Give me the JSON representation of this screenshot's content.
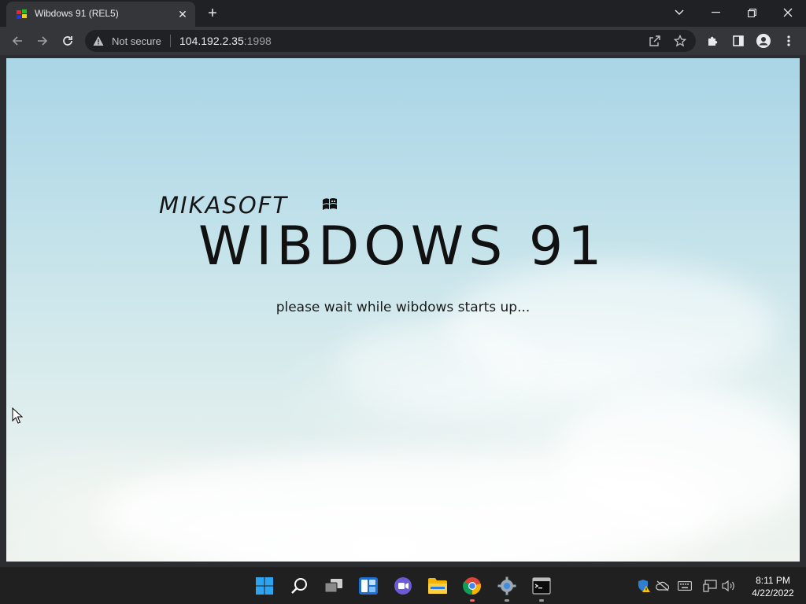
{
  "browser": {
    "tab": {
      "title": "Wibdows 91 (REL5)"
    },
    "address": {
      "security_label": "Not secure",
      "host": "104.192.2.35",
      "port": ":1998"
    }
  },
  "page": {
    "brand": "MIKASOFT",
    "product": "WIBDOWS 91",
    "status": "please wait while wibdows starts up..."
  },
  "taskbar": {
    "apps": [
      {
        "name": "start",
        "icon": "windows-logo-icon"
      },
      {
        "name": "search",
        "icon": "search-icon"
      },
      {
        "name": "task-view",
        "icon": "task-view-icon"
      },
      {
        "name": "widgets",
        "icon": "widgets-icon"
      },
      {
        "name": "chat",
        "icon": "chat-icon"
      },
      {
        "name": "file-explorer",
        "icon": "folder-icon"
      },
      {
        "name": "chrome",
        "icon": "chrome-icon"
      },
      {
        "name": "settings",
        "icon": "gear-icon"
      },
      {
        "name": "terminal",
        "icon": "terminal-icon"
      }
    ],
    "clock": {
      "time": "8:11 PM",
      "date": "4/22/2022"
    }
  },
  "colors": {
    "browser_dark": "#202124",
    "toolbar": "#35363a",
    "taskbar": "#202020",
    "sky_top": "#a9d5e6",
    "sky_bottom": "#eef3ee"
  }
}
